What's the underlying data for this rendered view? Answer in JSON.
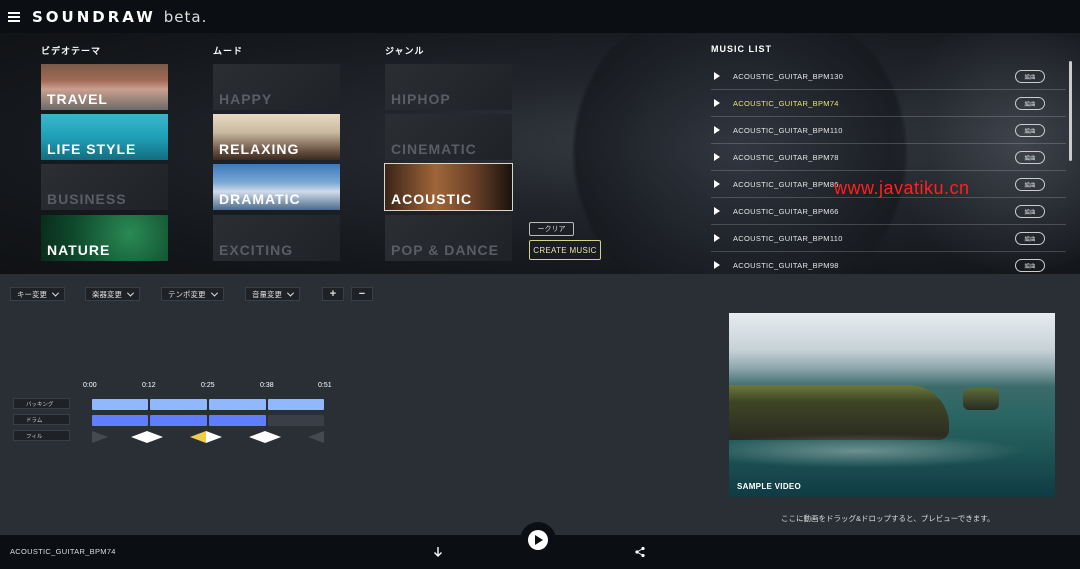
{
  "app": {
    "logo": "SOUNDRAW",
    "beta": "beta."
  },
  "columns": {
    "video_theme": "ビデオテーマ",
    "mood": "ムード",
    "genre": "ジャンル",
    "music_list": "MUSIC LIST"
  },
  "themes": [
    {
      "label": "TRAVEL",
      "active": true
    },
    {
      "label": "LIFE STYLE",
      "active": true
    },
    {
      "label": "BUSINESS",
      "active": false
    },
    {
      "label": "NATURE",
      "active": true
    }
  ],
  "moods": [
    {
      "label": "HAPPY",
      "active": false
    },
    {
      "label": "RELAXING",
      "active": true
    },
    {
      "label": "DRAMATIC",
      "active": true
    },
    {
      "label": "EXCITING",
      "active": false
    }
  ],
  "genres": [
    {
      "label": "HIPHOP",
      "active": false
    },
    {
      "label": "CINEMATIC",
      "active": false
    },
    {
      "label": "ACOUSTIC",
      "active": true
    },
    {
      "label": "POP & DANCE",
      "active": false
    }
  ],
  "buttons": {
    "clear": "ークリア",
    "create": "CREATE MUSIC"
  },
  "music_list": [
    {
      "name": "ACOUSTIC_GUITAR_BPM130",
      "edit": "編曲"
    },
    {
      "name": "ACOUSTIC_GUITAR_BPM74",
      "edit": "編曲",
      "current": true
    },
    {
      "name": "ACOUSTIC_GUITAR_BPM110",
      "edit": "編曲"
    },
    {
      "name": "ACOUSTIC_GUITAR_BPM78",
      "edit": "編曲"
    },
    {
      "name": "ACOUSTIC_GUITAR_BPM86",
      "edit": "編曲"
    },
    {
      "name": "ACOUSTIC_GUITAR_BPM66",
      "edit": "編曲"
    },
    {
      "name": "ACOUSTIC_GUITAR_BPM110",
      "edit": "編曲"
    },
    {
      "name": "ACOUSTIC_GUITAR_BPM98",
      "edit": "編曲"
    }
  ],
  "watermark": "www.javatiku.cn",
  "controls": {
    "key": "キー変更",
    "instrument": "楽器変更",
    "tempo": "テンポ変更",
    "volume": "音量変更",
    "plus": "+",
    "minus": "−"
  },
  "timeline": {
    "ticks": [
      "0:00",
      "0:12",
      "0:25",
      "0:38",
      "0:51"
    ],
    "tracks": [
      "バッキング",
      "ドラム",
      "フィル"
    ]
  },
  "video": {
    "label": "SAMPLE VIDEO",
    "hint": "ここに動画をドラッグ&ドロップすると、プレビューできます。"
  },
  "player": {
    "now_playing": "ACOUSTIC_GUITAR_BPM74"
  }
}
